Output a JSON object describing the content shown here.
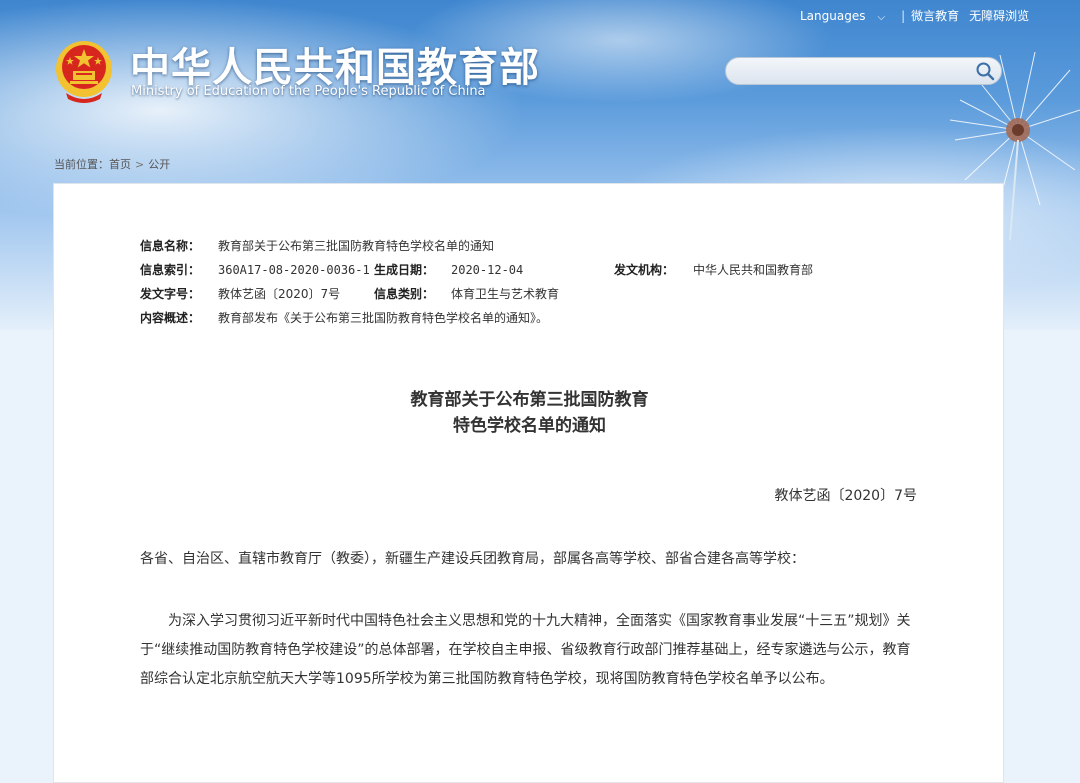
{
  "header": {
    "title_cn": "中华人民共和国教育部",
    "title_en": "Ministry of Education of the People's Republic of China",
    "languages_label": "Languages",
    "link_weiyan": "微言教育",
    "link_accessibility": "无障碍浏览",
    "search_placeholder": ""
  },
  "breadcrumb": {
    "prefix": "当前位置：",
    "home": "首页",
    "current": "公开"
  },
  "meta": {
    "name_label": "信息名称：",
    "name_value": "教育部关于公布第三批国防教育特色学校名单的通知",
    "index_label": "信息索引：",
    "index_value": "360A17-08-2020-0036-1",
    "date_label": "生成日期：",
    "date_value": "2020-12-04",
    "org_label": "发文机构：",
    "org_value": "中华人民共和国教育部",
    "docno_label": "发文字号：",
    "docno_value": "教体艺函〔2020〕7号",
    "category_label": "信息类别：",
    "category_value": "体育卫生与艺术教育",
    "summary_label": "内容概述：",
    "summary_value": "教育部发布《关于公布第三批国防教育特色学校名单的通知》。"
  },
  "document": {
    "title_line1": "教育部关于公布第三批国防教育",
    "title_line2": "特色学校名单的通知",
    "doc_no": "教体艺函〔2020〕7号",
    "addressee": "各省、自治区、直辖市教育厅（教委），新疆生产建设兵团教育局，部属各高等学校、部省合建各高等学校：",
    "paragraph1": "为深入学习贯彻习近平新时代中国特色社会主义思想和党的十九大精神，全面落实《国家教育事业发展“十三五”规划》关于“继续推动国防教育特色学校建设”的总体部署，在学校自主申报、省级教育行政部门推荐基础上，经专家遴选与公示，教育部综合认定北京航空航天大学等1095所学校为第三批国防教育特色学校，现将国防教育特色学校名单予以公布。"
  },
  "colors": {
    "sky_top": "#3f86cf",
    "emblem_red": "#d7261e",
    "emblem_gold": "#f2c230"
  }
}
